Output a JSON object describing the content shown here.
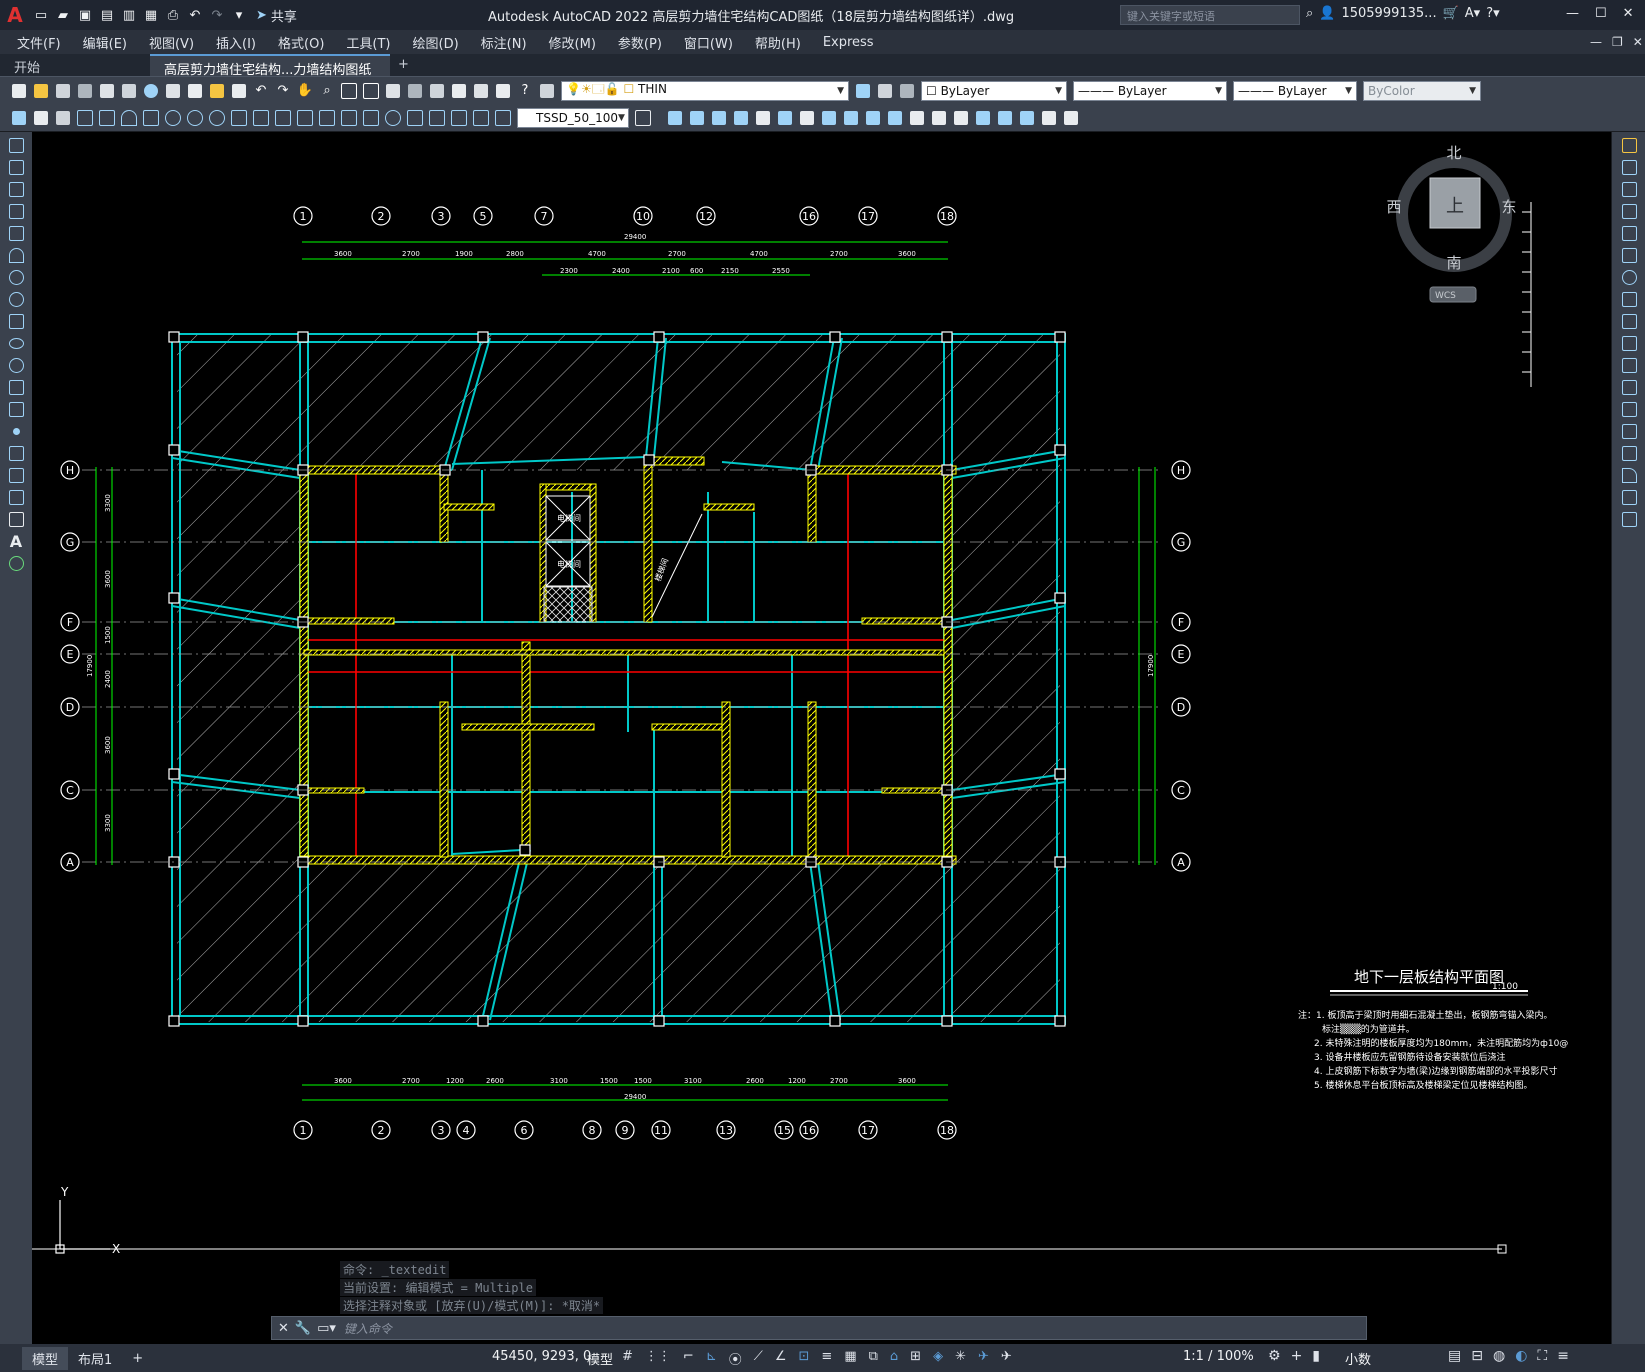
{
  "app": {
    "logo": "A",
    "title": "Autodesk AutoCAD 2022    高层剪力墙住宅结构CAD图纸（18层剪力墙结构图纸详）.dwg",
    "share_label": "共享",
    "search_placeholder": "键入关键字或短语",
    "user": "1505999135...",
    "icons": [
      "new-icon",
      "open-icon",
      "save-icon",
      "saveas-icon",
      "publish-icon",
      "plot-icon",
      "undo-icon",
      "redo-icon",
      "workspace-icon"
    ]
  },
  "menu": [
    "文件(F)",
    "编辑(E)",
    "视图(V)",
    "插入(I)",
    "格式(O)",
    "工具(T)",
    "绘图(D)",
    "标注(N)",
    "修改(M)",
    "参数(P)",
    "窗口(W)",
    "帮助(H)",
    "Express"
  ],
  "tabs": {
    "start": "开始",
    "drawing": "高层剪力墙住宅结构...力墙结构图纸详）*",
    "close": "×",
    "add": "+"
  },
  "toolbar": {
    "layer_name": "THIN",
    "color": "ByLayer",
    "linetype": "ByLayer",
    "lineweight": "ByLayer",
    "plotstyle": "ByColor",
    "dimstyle": "TSSD_50_100"
  },
  "viewcube": {
    "north": "北",
    "south": "南",
    "east": "东",
    "west": "西",
    "face": "上",
    "wcs": "WCS"
  },
  "drawing": {
    "top_axes": [
      "1",
      "2",
      "3",
      "5",
      "7",
      "10",
      "12",
      "16",
      "17",
      "18"
    ],
    "bottom_axes": [
      "1",
      "2",
      "3",
      "4",
      "6",
      "8",
      "9",
      "11",
      "13",
      "15",
      "16",
      "17",
      "18"
    ],
    "side_axes": [
      "H",
      "G",
      "F",
      "E",
      "D",
      "C",
      "A"
    ],
    "total_dim": "29400",
    "top_dims": [
      "3600",
      "2700",
      "1900",
      "2800",
      "4700",
      "2700",
      "4700",
      "2700",
      "3600"
    ],
    "top_dims2": [
      "2300",
      "2400",
      "2100",
      "600",
      "2150",
      "2550"
    ],
    "bottom_dims": [
      "3600",
      "2700",
      "1200",
      "2600",
      "3100",
      "1500",
      "1500",
      "3100",
      "2600",
      "1200",
      "2700",
      "3600"
    ],
    "left_dims": [
      "3300",
      "3600",
      "1500",
      "2400",
      "3600",
      "3300"
    ],
    "left_total": "17900",
    "right_total": "17900",
    "room_labels": [
      "电梯间",
      "电梯间",
      "楼梯间"
    ],
    "plan_title": "地下一层板结构平面图",
    "scale": "1:100",
    "notes": [
      "注：1. 板顶高于梁顶时用细石混凝土垫出，板钢筋弯锚入梁内。",
      "标注▒▒▒的为管道井。",
      "2. 未特殊注明的楼板厚度均为180mm，未注明配筋均为ф10@",
      "3. 设备井楼板应先留钢筋待设备安装就位后浇注",
      "4. 上皮钢筋下标数字为墙(梁)边缘到钢筋端部的水平投影尺寸",
      "5. 楼梯休息平台板顶标高及楼梯梁定位见楼梯结构图。"
    ],
    "ucs_x": "X",
    "ucs_y": "Y"
  },
  "command": {
    "history": [
      "命令: _textedit",
      "当前设置: 编辑模式 = Multiple",
      "选择注释对象或 [放弃(U)/模式(M)]: *取消*"
    ],
    "placeholder": "键入命令"
  },
  "status": {
    "model_tab": "模型",
    "layout_tab": "布局1",
    "add_tab": "+",
    "coords": "45450, 9293, 0",
    "space": "模型",
    "scale": "1:1 / 100%",
    "units": "小数"
  },
  "colors": {
    "wall": "#00c8c8",
    "shear_wall": "#ffff00",
    "axis_circle": "#ffffff",
    "dim": "#00ff00",
    "beam_red": "#ff0000",
    "accent": "#5b9bd5"
  }
}
